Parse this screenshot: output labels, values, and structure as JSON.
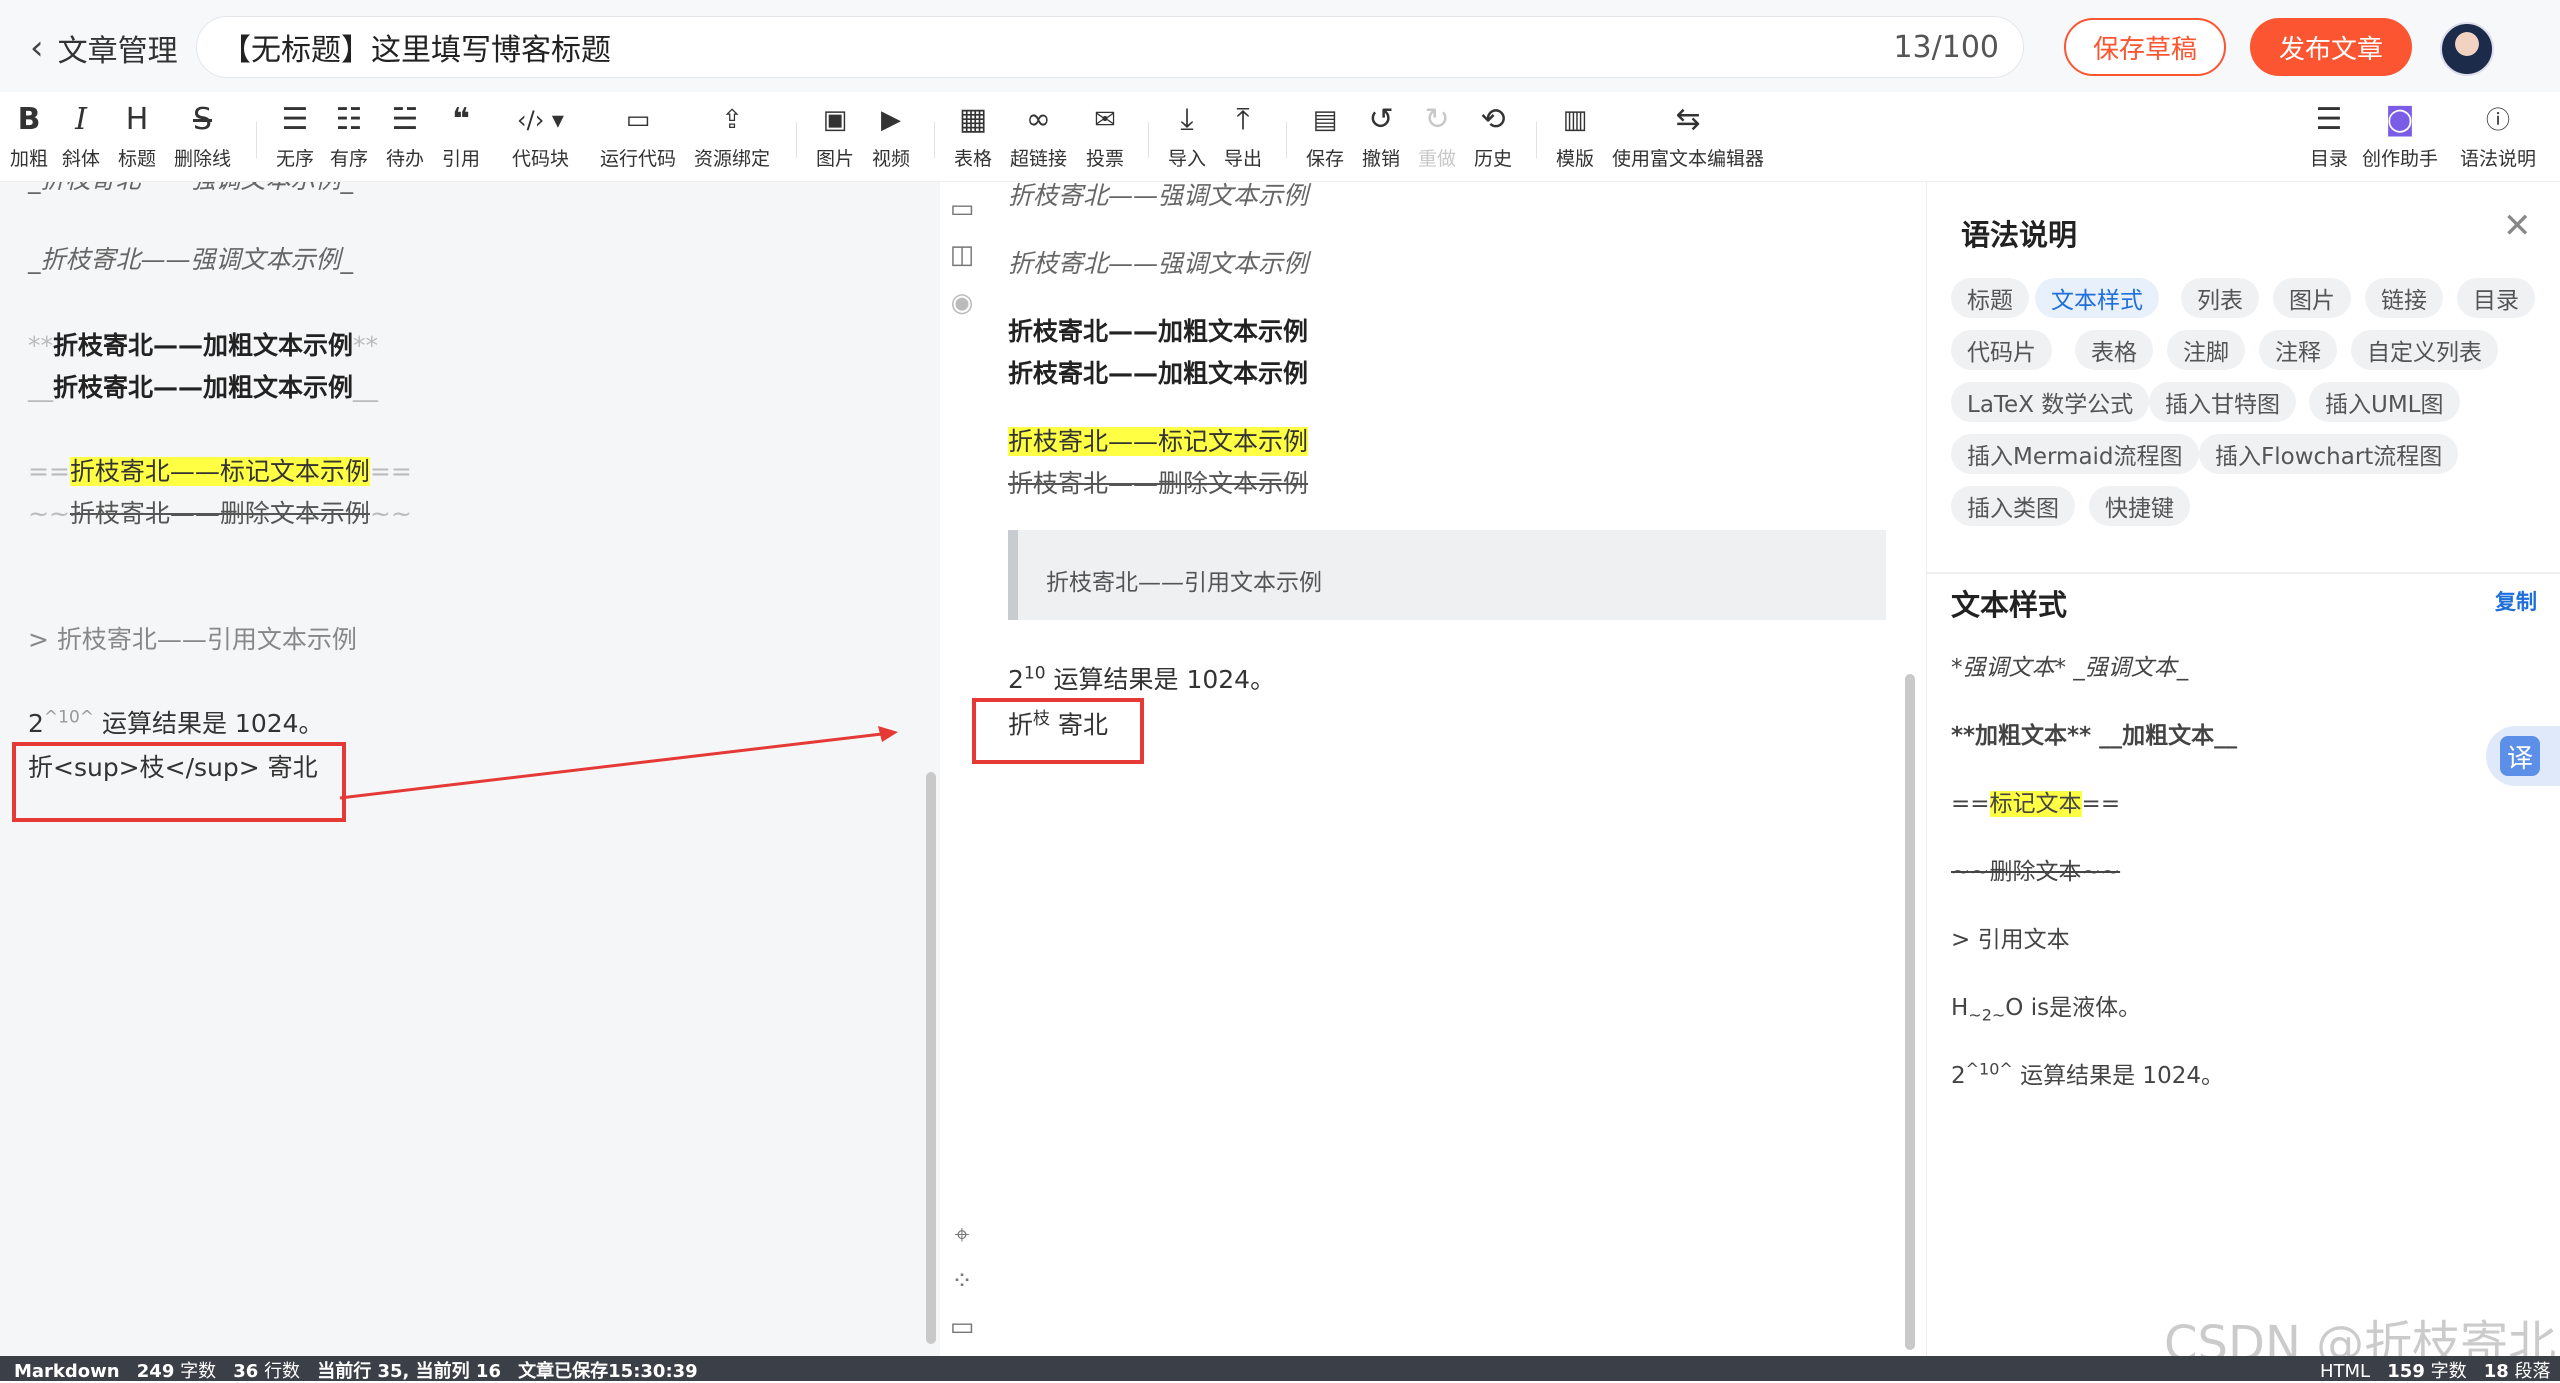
{
  "header": {
    "back_label": "文章管理",
    "title": "【无标题】这里填写博客标题",
    "counter": "13/100",
    "save_draft": "保存草稿",
    "publish": "发布文章"
  },
  "toolbar": {
    "bold": "加粗",
    "italic": "斜体",
    "heading": "标题",
    "strike": "删除线",
    "unordered": "无序",
    "ordered": "有序",
    "todo": "待办",
    "quote": "引用",
    "codeblock": "代码块",
    "runcode": "运行代码",
    "resource": "资源绑定",
    "image": "图片",
    "video": "视频",
    "table": "表格",
    "link": "超链接",
    "vote": "投票",
    "import": "导入",
    "export": "导出",
    "save": "保存",
    "undo": "撤销",
    "redo": "重做",
    "history": "历史",
    "template": "模版",
    "richtext": "使用富文本编辑器",
    "toc": "目录",
    "assistant": "创作助手",
    "syntax": "语法说明"
  },
  "editor": {
    "l0": "_折枝寄北——强调文本示例_",
    "l1": "_折枝寄北——强调文本示例_",
    "l2_mk1": "**",
    "l2_text": "折枝寄北——加粗文本示例",
    "l2_mk2": "**",
    "l3_mk1": "__",
    "l3_text": "折枝寄北——加粗文本示例",
    "l3_mk2": "__",
    "l4_mk1": "==",
    "l4_text": "折枝寄北——标记文本示例",
    "l4_mk2": "==",
    "l5_mk1": "~~",
    "l5_text": "折枝寄北——删除文本示例",
    "l5_mk2": "~~",
    "l6": "> 折枝寄北——引用文本示例",
    "l7_base": "2",
    "l7_sup": "^10^",
    "l7_rest": " 运算结果是 1024。",
    "l8": "折<sup>枝</sup> 寄北"
  },
  "preview": {
    "p0": "折枝寄北——强调文本示例",
    "p1": "折枝寄北——强调文本示例",
    "p2": "折枝寄北——加粗文本示例",
    "p3": "折枝寄北——加粗文本示例",
    "p4": "折枝寄北——标记文本示例",
    "p5": "折枝寄北——删除文本示例",
    "quote": "折枝寄北——引用文本示例",
    "p7_base": "2",
    "p7_sup": "10",
    "p7_rest": " 运算结果是 1024。",
    "p8_a": "折",
    "p8_sup": "枝",
    "p8_b": " 寄北"
  },
  "syntax_panel": {
    "title": "语法说明",
    "chips": [
      "标题",
      "文本样式",
      "列表",
      "图片",
      "链接",
      "目录",
      "代码片",
      "表格",
      "注脚",
      "注释",
      "自定义列表",
      "LaTeX 数学公式",
      "插入甘特图",
      "插入UML图",
      "插入Mermaid流程图",
      "插入Flowchart流程图",
      "插入类图",
      "快捷键"
    ],
    "section_title": "文本样式",
    "copy": "复制",
    "line1": "*强调文本* _强调文本_",
    "line2": "**加粗文本** __加粗文本__",
    "line3_a": "==",
    "line3_b": "标记文本",
    "line3_c": "==",
    "line4": "~~删除文本~~",
    "line5": "> 引用文本",
    "line6_a": "H",
    "line6_b": "~2~",
    "line6_c": "O is是液体。",
    "line7_a": "2",
    "line7_b": "^10^",
    "line7_c": " 运算结果是 1024。",
    "translate": "译"
  },
  "status": {
    "mode": "Markdown",
    "chars": "249",
    "chars_label": "字数",
    "lines": "36",
    "lines_label": "行数",
    "cursor": "当前行 35, 当前列 16",
    "saved": "文章已保存15:30:39",
    "right_mode": "HTML",
    "right_chars": "159",
    "right_chars_label": "字数",
    "paragraphs": "18",
    "paragraphs_label": "段落"
  },
  "watermark": "CSDN @折枝寄北"
}
